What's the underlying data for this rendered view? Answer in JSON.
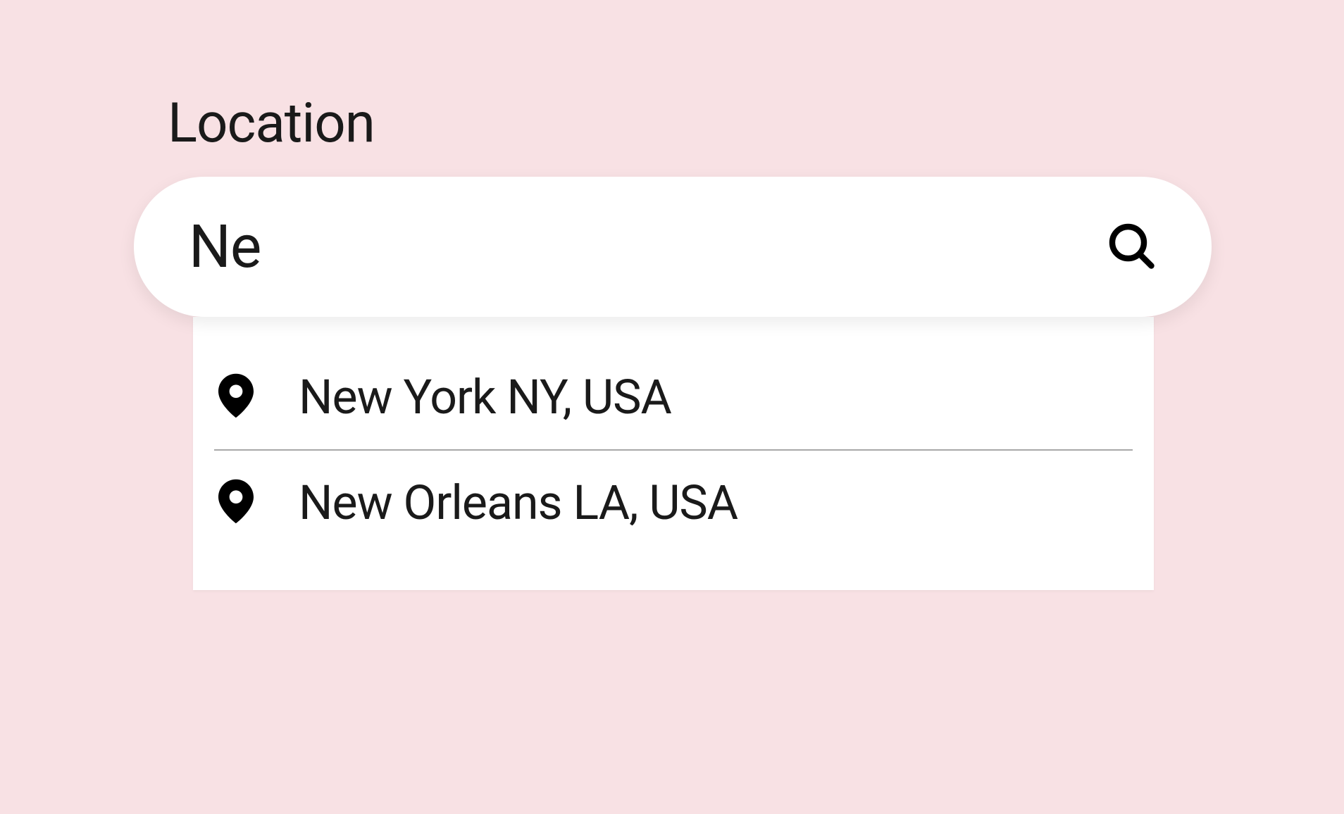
{
  "search": {
    "label": "Location",
    "value": "Ne",
    "placeholder": ""
  },
  "suggestions": [
    {
      "label": "New York NY, USA"
    },
    {
      "label": "New Orleans LA, USA"
    }
  ]
}
